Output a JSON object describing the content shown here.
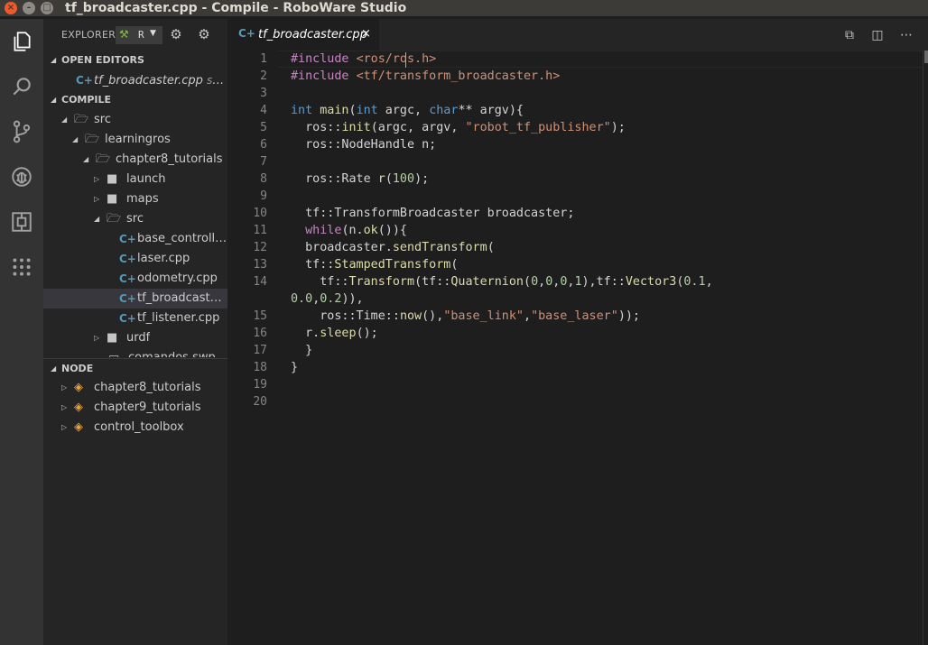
{
  "window": {
    "title": "tf_broadcaster.cpp - Compile - RoboWare Studio",
    "close_glyph": "×",
    "min_glyph": "–",
    "max_glyph": "□"
  },
  "activity_bar": {
    "items": [
      "explorer-icon",
      "search-icon",
      "source-control-icon",
      "debug-icon",
      "extensions-icon",
      "more-icon"
    ]
  },
  "sidebar": {
    "title": "EXPLORER",
    "project_selector": {
      "value": "R",
      "icon": "hammer-icon"
    },
    "open_editors": {
      "label": "OPEN EDITORS",
      "items": [
        {
          "name": "tf_broadcaster.cpp",
          "path": "src/l..."
        }
      ]
    },
    "compile": {
      "label": "COMPILE",
      "tree": [
        {
          "label": "src",
          "type": "folder",
          "expanded": true
        },
        {
          "label": "learningros",
          "type": "folder",
          "expanded": true
        },
        {
          "label": "chapter8_tutorials",
          "type": "folder",
          "expanded": true
        },
        {
          "label": "launch",
          "type": "folder",
          "expanded": false
        },
        {
          "label": "maps",
          "type": "folder",
          "expanded": false
        },
        {
          "label": "src",
          "type": "folder",
          "expanded": true
        },
        {
          "label": "base_controlle...",
          "type": "cpp"
        },
        {
          "label": "laser.cpp",
          "type": "cpp"
        },
        {
          "label": "odometry.cpp",
          "type": "cpp"
        },
        {
          "label": "tf_broadcaster.c...",
          "type": "cpp",
          "selected": true
        },
        {
          "label": "tf_listener.cpp",
          "type": "cpp"
        },
        {
          "label": "urdf",
          "type": "folder",
          "expanded": false
        },
        {
          "label": "comandos.swp",
          "type": "file"
        }
      ]
    },
    "node": {
      "label": "NODE",
      "items": [
        "chapter8_tutorials",
        "chapter9_tutorials",
        "control_toolbox"
      ]
    }
  },
  "editor": {
    "tab": {
      "label": "tf_broadcaster.cpp",
      "close": "×"
    },
    "line_numbers": [
      "1",
      "2",
      "3",
      "4",
      "5",
      "6",
      "7",
      "8",
      "9",
      "10",
      "11",
      "12",
      "13",
      "14",
      "15",
      "16",
      "17",
      "18",
      "19",
      "20"
    ]
  },
  "colors": {
    "keyword": "#569cd6",
    "string": "#ce9178",
    "number": "#b5cea8",
    "function": "#dcdcaa",
    "preprocessor": "#c586c0",
    "cpp_icon": "#519aba",
    "package_icon": "#e8a33d"
  }
}
